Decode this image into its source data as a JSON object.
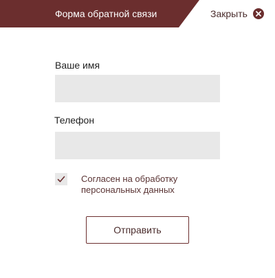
{
  "header": {
    "title": "Форма обратной связи",
    "close_label": "Закрыть"
  },
  "form": {
    "name_label": "Ваше имя",
    "name_value": "",
    "phone_label": "Телефон",
    "phone_value": "",
    "consent_checked": true,
    "consent_text": "Согласен на обработку персональных данных",
    "submit_label": "Отправить"
  },
  "icons": {
    "close": "close-circle-icon",
    "check": "checkmark-icon"
  },
  "colors": {
    "brand": "#6b2e2e",
    "input_bg": "#e8e8e8",
    "text_dark": "#222222",
    "text_brown": "#4a2c2c"
  }
}
